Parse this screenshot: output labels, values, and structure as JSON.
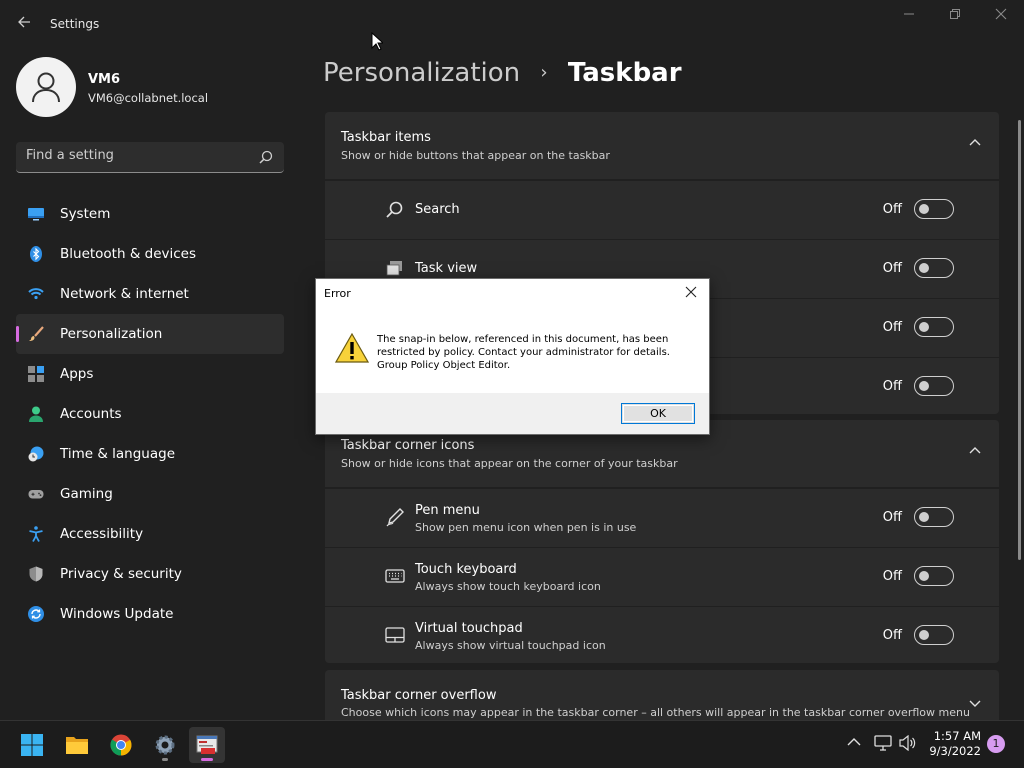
{
  "window": {
    "title": "Settings",
    "back_icon": "back-arrow-icon",
    "controls": [
      "minimize-icon",
      "maximize-icon",
      "close-icon"
    ]
  },
  "profile": {
    "name": "VM6",
    "email": "VM6@collabnet.local"
  },
  "search": {
    "placeholder": "Find a setting"
  },
  "sidebar": {
    "items": [
      {
        "label": "System",
        "icon": "system-icon"
      },
      {
        "label": "Bluetooth & devices",
        "icon": "bluetooth-icon"
      },
      {
        "label": "Network & internet",
        "icon": "wifi-icon"
      },
      {
        "label": "Personalization",
        "icon": "brush-icon",
        "active": true
      },
      {
        "label": "Apps",
        "icon": "apps-icon"
      },
      {
        "label": "Accounts",
        "icon": "accounts-icon"
      },
      {
        "label": "Time & language",
        "icon": "clock-globe-icon"
      },
      {
        "label": "Gaming",
        "icon": "gamepad-icon"
      },
      {
        "label": "Accessibility",
        "icon": "accessibility-icon"
      },
      {
        "label": "Privacy & security",
        "icon": "shield-icon"
      },
      {
        "label": "Windows Update",
        "icon": "update-icon"
      }
    ]
  },
  "breadcrumb": {
    "parent": "Personalization",
    "separator": "›",
    "current": "Taskbar"
  },
  "groups": {
    "taskbar_items": {
      "title": "Taskbar items",
      "subtitle": "Show or hide buttons that appear on the taskbar",
      "rows": [
        {
          "title": "Search",
          "state": "Off",
          "icon": "search-icon"
        },
        {
          "title": "Task view",
          "state": "Off",
          "icon": "task-view-icon"
        },
        {
          "state": "Off"
        },
        {
          "state": "Off"
        }
      ]
    },
    "corner_icons": {
      "title": "Taskbar corner icons",
      "subtitle": "Show or hide icons that appear on the corner of your taskbar",
      "rows": [
        {
          "title": "Pen menu",
          "subtitle": "Show pen menu icon when pen is in use",
          "state": "Off",
          "icon": "pen-icon"
        },
        {
          "title": "Touch keyboard",
          "subtitle": "Always show touch keyboard icon",
          "state": "Off",
          "icon": "keyboard-icon"
        },
        {
          "title": "Virtual touchpad",
          "subtitle": "Always show virtual touchpad icon",
          "state": "Off",
          "icon": "touchpad-icon"
        }
      ]
    },
    "corner_overflow": {
      "title": "Taskbar corner overflow",
      "subtitle": "Choose which icons may appear in the taskbar corner – all others will appear in the taskbar corner overflow menu"
    }
  },
  "dialog": {
    "title": "Error",
    "message_line1": "The snap-in below, referenced in this document, has been",
    "message_line2": "restricted by policy. Contact your administrator for details.",
    "message_line3": "Group Policy Object Editor.",
    "ok_label": "OK",
    "icon": "warning-icon"
  },
  "taskbar": {
    "apps": [
      "start-icon",
      "file-explorer-icon",
      "chrome-icon",
      "settings-icon",
      "group-policy-icon"
    ],
    "time": "1:57 AM",
    "date": "9/3/2022",
    "notification_count": "1"
  },
  "colors": {
    "accent": "#d66be0",
    "background": "#202020",
    "card": "#2b2b2b"
  }
}
